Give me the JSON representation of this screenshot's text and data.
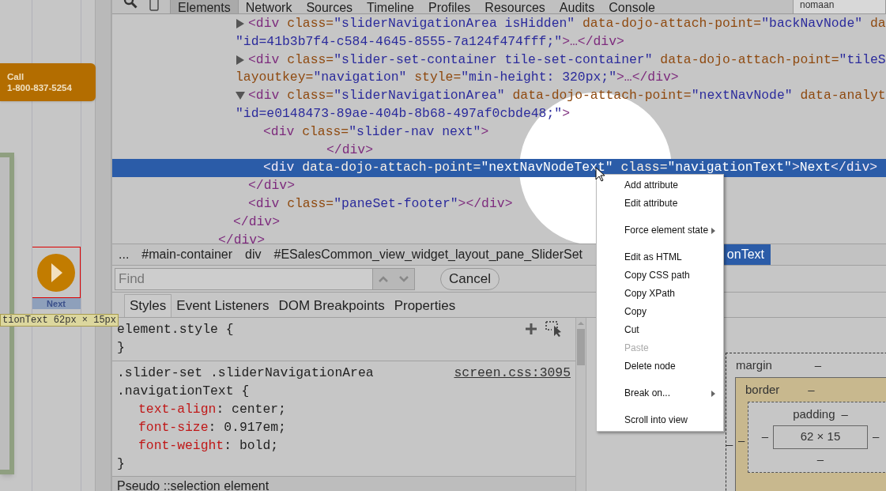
{
  "page": {
    "call_badge": {
      "label": "Call",
      "phone": "1-800-837-5254"
    },
    "next_button": {
      "label": "Next"
    },
    "tooltip": "tionText 62px × 15px"
  },
  "devtools": {
    "tabs": [
      {
        "label": "Elements",
        "selected": true
      },
      {
        "label": "Network",
        "selected": false
      },
      {
        "label": "Sources",
        "selected": false
      },
      {
        "label": "Timeline",
        "selected": false
      },
      {
        "label": "Profiles",
        "selected": false
      },
      {
        "label": "Resources",
        "selected": false
      },
      {
        "label": "Audits",
        "selected": false
      },
      {
        "label": "Console",
        "selected": false
      }
    ],
    "search_value": "nomaan",
    "dom_tree": [
      {
        "close": [
          {
            "kind": "tag",
            "text": "</div>"
          }
        ],
        "children": [
          {
            "close": [
              {
                "kind": "tag",
                "text": "</div>"
              }
            ],
            "children": [
              {
                "expanded": false,
                "selected": false,
                "lines": [
                  [
                    {
                      "kind": "tag",
                      "text": "<div "
                    },
                    {
                      "kind": "attr",
                      "text": "class="
                    },
                    {
                      "kind": "val",
                      "text": "\"sliderNavigationArea isHidden\""
                    },
                    {
                      "kind": "attr",
                      "text": " data-dojo-attach-point="
                    },
                    {
                      "kind": "val",
                      "text": "\"backNavNode\""
                    },
                    {
                      "kind": "attr",
                      "text": " da"
                    }
                  ],
                  [
                    {
                      "kind": "val",
                      "text": "\"id=41b3b7f4-c584-4645-8555-7a124f474fff;\""
                    },
                    {
                      "kind": "tag",
                      "text": ">…</div>"
                    }
                  ]
                ]
              },
              {
                "expanded": false,
                "selected": false,
                "lines": [
                  [
                    {
                      "kind": "tag",
                      "text": "<div "
                    },
                    {
                      "kind": "attr",
                      "text": "class="
                    },
                    {
                      "kind": "val",
                      "text": "\"slider-set-container tile-set-container\""
                    },
                    {
                      "kind": "attr",
                      "text": " data-dojo-attach-point="
                    },
                    {
                      "kind": "val",
                      "text": "\"tileS"
                    }
                  ],
                  [
                    {
                      "kind": "attr",
                      "text": "layoutkey="
                    },
                    {
                      "kind": "val",
                      "text": "\"navigation\""
                    },
                    {
                      "kind": "attr",
                      "text": " style="
                    },
                    {
                      "kind": "val",
                      "text": "\"min-height: 320px;\""
                    },
                    {
                      "kind": "tag",
                      "text": ">…</div>"
                    }
                  ]
                ]
              },
              {
                "expanded": true,
                "selected": false,
                "lines": [
                  [
                    {
                      "kind": "tag",
                      "text": "<div "
                    },
                    {
                      "kind": "attr",
                      "text": "class="
                    },
                    {
                      "kind": "val",
                      "text": "\"sliderNavigationArea\""
                    },
                    {
                      "kind": "attr",
                      "text": " data-dojo-attach-point="
                    },
                    {
                      "kind": "val",
                      "text": "\"nextNavNode\""
                    },
                    {
                      "kind": "attr",
                      "text": " data-analyt"
                    }
                  ],
                  [
                    {
                      "kind": "val",
                      "text": "\"id=e0148473-89ae-404b-8b68-497af0cbde48;\""
                    },
                    {
                      "kind": "tag",
                      "text": ">"
                    }
                  ]
                ],
                "close": [
                  {
                    "kind": "tag",
                    "text": "</div>"
                  }
                ],
                "children": [
                  {
                    "selected": false,
                    "lines": [
                      [
                        {
                          "kind": "tag",
                          "text": "<div "
                        },
                        {
                          "kind": "attr",
                          "text": "class="
                        },
                        {
                          "kind": "val",
                          "text": "\"slider-nav next\""
                        },
                        {
                          "kind": "tag",
                          "text": ">"
                        }
                      ]
                    ],
                    "close": [
                      {
                        "kind": "tag",
                        "text": "</div>"
                      }
                    ]
                  },
                  {
                    "selected": true,
                    "lines": [
                      [
                        {
                          "kind": "tag",
                          "text": "<div "
                        },
                        {
                          "kind": "attr",
                          "text": "data-dojo-attach-point="
                        },
                        {
                          "kind": "val",
                          "text": "\"nextNavNodeText\""
                        },
                        {
                          "kind": "attr",
                          "text": " class="
                        },
                        {
                          "kind": "val",
                          "text": "\"navigationText\""
                        },
                        {
                          "kind": "tag",
                          "text": ">"
                        },
                        {
                          "kind": "text",
                          "text": "Next"
                        },
                        {
                          "kind": "tag",
                          "text": "</div>"
                        }
                      ]
                    ]
                  }
                ]
              },
              {
                "selected": false,
                "lines": [
                  [
                    {
                      "kind": "tag",
                      "text": "<div "
                    },
                    {
                      "kind": "attr",
                      "text": "class="
                    },
                    {
                      "kind": "val",
                      "text": "\"paneSet-footer\""
                    },
                    {
                      "kind": "tag",
                      "text": "></div>"
                    }
                  ]
                ]
              }
            ]
          }
        ]
      }
    ],
    "breadcrumbs": [
      {
        "label": "...",
        "selected": false
      },
      {
        "label": "#main-container",
        "selected": false
      },
      {
        "label": "div",
        "selected": false
      },
      {
        "label": "#ESalesCommon_view_widget_layout_pane_SliderSet",
        "selected": false
      },
      {
        "label": "onText",
        "selected": true
      }
    ],
    "find": {
      "placeholder": "Find",
      "cancel": "Cancel"
    },
    "sidebar_tabs": [
      {
        "label": "Styles",
        "selected": true
      },
      {
        "label": "Event Listeners",
        "selected": false
      },
      {
        "label": "DOM Breakpoints",
        "selected": false
      },
      {
        "label": "Properties",
        "selected": false
      }
    ],
    "styles": {
      "element_style": {
        "open": "element.style {",
        "close": "}"
      },
      "rule": {
        "selector": [
          ".slider-set .sliderNavigationArea",
          ".navigationText {"
        ],
        "source": "screen.css:3095",
        "properties": [
          {
            "name": "text-align",
            "value": ": center;"
          },
          {
            "name": "font-size",
            "value": ": 0.917em;"
          },
          {
            "name": "font-weight",
            "value": ": bold;"
          }
        ],
        "close": "}"
      },
      "pseudo_header": "Pseudo ::selection element"
    },
    "metrics": {
      "margin_label": "margin",
      "margin": "–",
      "border_label": "border",
      "border": "–",
      "padding_label": "padding",
      "padding": "–",
      "padding_bottom": "–",
      "content": "62 × 15",
      "margin_left": "–",
      "border_left": "–",
      "padding_left": "–",
      "padding_right": "–"
    }
  },
  "context_menu": [
    {
      "kind": "item",
      "label": "Add attribute",
      "disabled": false
    },
    {
      "kind": "item",
      "label": "Edit attribute",
      "disabled": false
    },
    {
      "kind": "separator"
    },
    {
      "kind": "submenu",
      "label": "Force element state",
      "disabled": false
    },
    {
      "kind": "separator"
    },
    {
      "kind": "item",
      "label": "Edit as HTML",
      "disabled": false
    },
    {
      "kind": "item",
      "label": "Copy CSS path",
      "disabled": false
    },
    {
      "kind": "item",
      "label": "Copy XPath",
      "disabled": false
    },
    {
      "kind": "item",
      "label": "Copy",
      "disabled": false
    },
    {
      "kind": "item",
      "label": "Cut",
      "disabled": false
    },
    {
      "kind": "item",
      "label": "Paste",
      "disabled": true
    },
    {
      "kind": "item",
      "label": "Delete node",
      "disabled": false
    },
    {
      "kind": "separator"
    },
    {
      "kind": "submenu",
      "label": "Break on...",
      "disabled": false
    },
    {
      "kind": "separator"
    },
    {
      "kind": "item",
      "label": "Scroll into view",
      "disabled": false
    }
  ]
}
